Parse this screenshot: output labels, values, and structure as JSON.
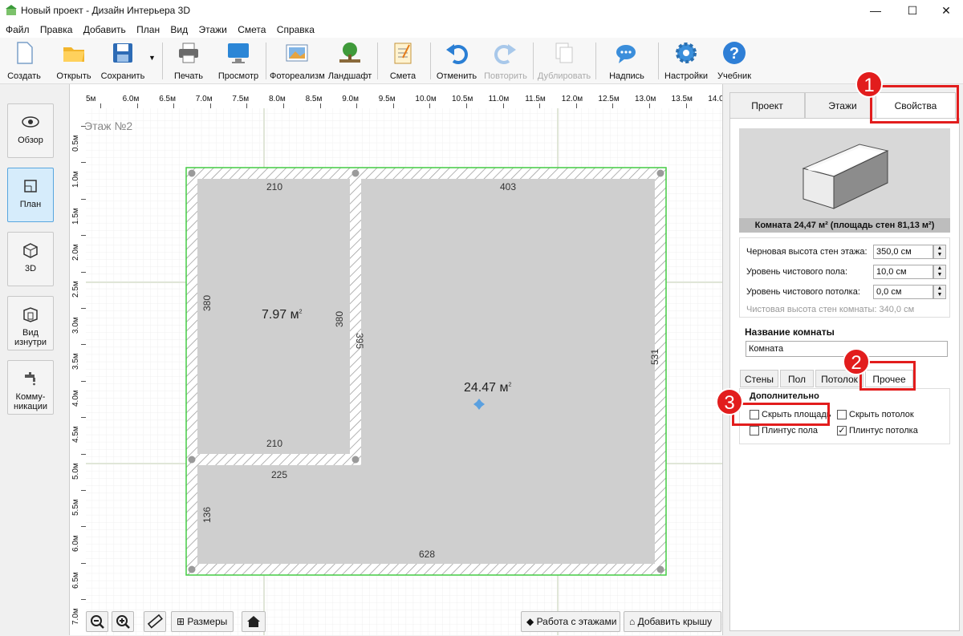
{
  "window": {
    "title": "Новый проект - Дизайн Интерьера 3D",
    "minimize": "—",
    "maximize": "☐",
    "close": "✕"
  },
  "menu": [
    "Файл",
    "Правка",
    "Добавить",
    "План",
    "Вид",
    "Этажи",
    "Смета",
    "Справка"
  ],
  "toolbar": {
    "create": "Создать",
    "open": "Открыть",
    "save": "Сохранить",
    "print": "Печать",
    "preview": "Просмотр",
    "photo": "Фотореализм",
    "landscape": "Ландшафт",
    "estimate": "Смета",
    "undo": "Отменить",
    "redo": "Повторить",
    "duplicate": "Дублировать",
    "caption": "Надпись",
    "settings": "Настройки",
    "tutorial": "Учебник"
  },
  "left": {
    "overview": "Обзор",
    "plan": "План",
    "view3d": "3D",
    "inside_1": "Вид",
    "inside_2": "изнутри",
    "comm_1": "Комму-",
    "comm_2": "никации"
  },
  "ruler": {
    "h": [
      "5м",
      "6.0м",
      "6.5м",
      "7.0м",
      "7.5м",
      "8.0м",
      "8.5м",
      "9.0м",
      "9.5м",
      "10.0м",
      "10.5м",
      "11.0м",
      "11.5м",
      "12.0м",
      "12.5м",
      "13.0м",
      "13.5м",
      "14.0м"
    ],
    "v": [
      "0.5м",
      "1.0м",
      "1.5м",
      "2.0м",
      "2.5м",
      "3.0м",
      "3.5м",
      "4.0м",
      "4.5м",
      "5.0м",
      "5.5м",
      "6.0м",
      "6.5м",
      "7.0м"
    ]
  },
  "plan": {
    "floor_label": "Этаж №2",
    "dims": {
      "top_small": "210",
      "top_big": "403",
      "left_small": "380",
      "right_small": "380",
      "mid_wall": "395",
      "bottom_small": "210",
      "under_small": "225",
      "right_big": "531",
      "left_lower": "136",
      "bottom_big": "628"
    },
    "area_small": "7.97 м",
    "area_big": "24.47 м",
    "sup": "2"
  },
  "bottom": {
    "zoom_out_icon": "zoom-out-icon",
    "dimensions": "Размеры",
    "floors_work": "Работа с этажами",
    "add_roof": "Добавить крышу"
  },
  "right": {
    "tabs": [
      "Проект",
      "Этажи",
      "Свойства"
    ],
    "room_caption": "Комната 24,47 м²  (площадь стен 81,13 м²)",
    "rough_height_label": "Черновая высота стен этажа:",
    "rough_height_value": "350,0 см",
    "floor_level_label": "Уровень чистового пола:",
    "floor_level_value": "10,0 см",
    "ceiling_level_label": "Уровень чистового потолка:",
    "ceiling_level_value": "0,0 см",
    "clean_height": "Чистовая высота стен комнаты: 340,0 см",
    "room_name_label": "Название комнаты",
    "room_name_value": "Комната",
    "subtabs": [
      "Стены",
      "Пол",
      "Потолок",
      "Прочее"
    ],
    "extra_title": "Дополнительно",
    "hide_area": "Скрыть площадь",
    "hide_ceiling": "Скрыть потолок",
    "floor_plinth": "Плинтус пола",
    "ceiling_plinth": "Плинтус потолка",
    "ceiling_plinth_checked": true
  },
  "badges": [
    "1",
    "2",
    "3"
  ],
  "colors": {
    "accent": "#e21d1d",
    "room_fill": "#cfcfcf",
    "selection": "#44cc44"
  }
}
